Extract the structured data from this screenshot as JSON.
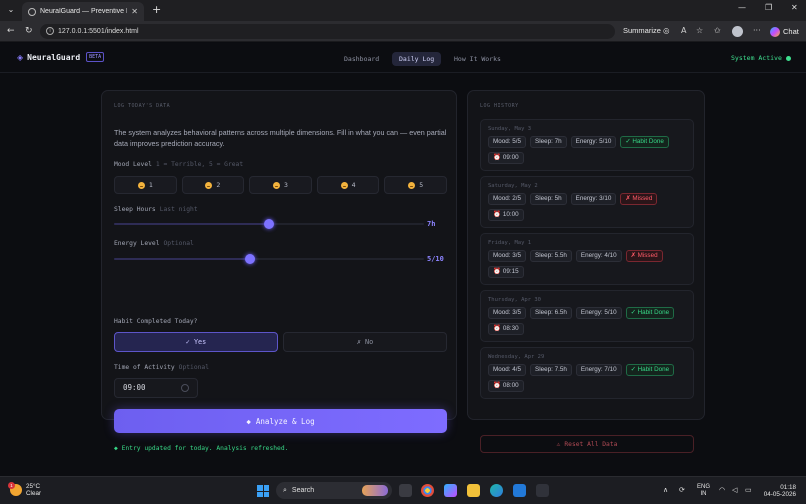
{
  "browser": {
    "tab_title": "NeuralGuard — Preventive Healt…",
    "url": "127.0.0.1:5501/index.html",
    "summarize_label": "Summarize",
    "chat_label": "Chat"
  },
  "app": {
    "name": "NeuralGuard",
    "badge": "BETA",
    "nav": [
      "Dashboard",
      "Daily Log",
      "How It Works"
    ],
    "status": "System Active"
  },
  "form": {
    "section_label": "LOG TODAY'S DATA",
    "intro": "The system analyzes behavioral patterns across multiple dimensions. Fill in what you can — even partial data improves prediction accuracy.",
    "mood_label": "Mood Level",
    "mood_hint": "1 = Terrible, 5 = Great",
    "mood_options": [
      "1",
      "2",
      "3",
      "4",
      "5"
    ],
    "sleep_label": "Sleep Hours",
    "sleep_hint": "Last night",
    "sleep_value": "7h",
    "sleep_fraction": 0.5,
    "energy_label": "Energy Level",
    "energy_hint": "Optional",
    "energy_value": "5/10",
    "energy_fraction": 0.44,
    "habit_label": "Habit Completed Today?",
    "habit_yes": "✓ Yes",
    "habit_no": "✗ No",
    "time_label": "Time of Activity",
    "time_hint": "Optional",
    "time_value": "09:00",
    "analyze_label": "Analyze & Log",
    "success_msg": "Entry updated for today. Analysis refreshed."
  },
  "history": {
    "section_label": "LOG HISTORY",
    "entries": [
      {
        "date": "Sunday, May 3",
        "mood": "Mood: 5/5",
        "sleep": "Sleep: 7h",
        "energy": "Energy: 5/10",
        "habit": "✓ Habit Done",
        "habit_status": "done",
        "time": "09:00"
      },
      {
        "date": "Saturday, May 2",
        "mood": "Mood: 2/5",
        "sleep": "Sleep: 5h",
        "energy": "Energy: 3/10",
        "habit": "✗ Missed",
        "habit_status": "missed",
        "time": "10:00"
      },
      {
        "date": "Friday, May 1",
        "mood": "Mood: 3/5",
        "sleep": "Sleep: 5.5h",
        "energy": "Energy: 4/10",
        "habit": "✗ Missed",
        "habit_status": "missed",
        "time": "09:15"
      },
      {
        "date": "Thursday, Apr 30",
        "mood": "Mood: 3/5",
        "sleep": "Sleep: 6.5h",
        "energy": "Energy: 5/10",
        "habit": "✓ Habit Done",
        "habit_status": "done",
        "time": "08:30"
      },
      {
        "date": "Wednesday, Apr 29",
        "mood": "Mood: 4/5",
        "sleep": "Sleep: 7.5h",
        "energy": "Energy: 7/10",
        "habit": "✓ Habit Done",
        "habit_status": "done",
        "time": "08:00"
      }
    ],
    "reset_label": "Reset All Data"
  },
  "taskbar": {
    "weather_temp": "25°C",
    "weather_desc": "Clear",
    "weather_badge": "1",
    "search_placeholder": "Search",
    "lang_1": "ENG",
    "lang_2": "IN",
    "time": "01:18",
    "date": "04-05-2026"
  },
  "colors": {
    "accent": "#7d72ff",
    "success": "#37d787",
    "danger": "#ff5a67",
    "background": "#0c0d11"
  }
}
